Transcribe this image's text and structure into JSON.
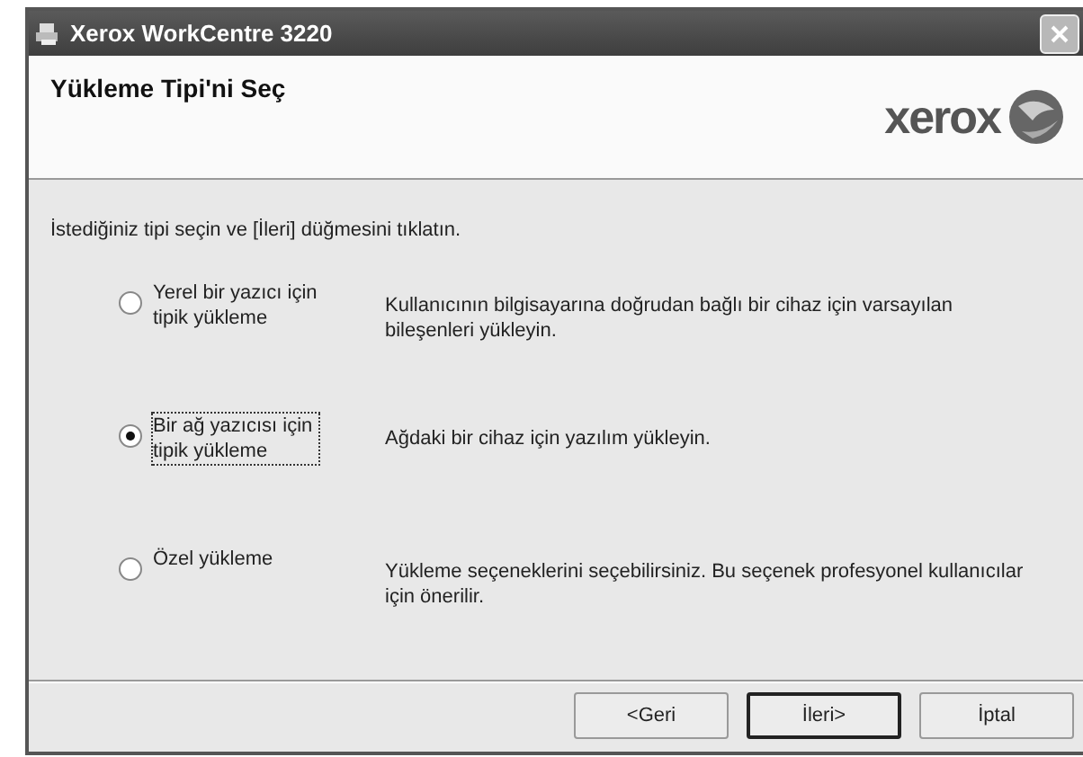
{
  "window": {
    "title": "Xerox WorkCentre 3220"
  },
  "header": {
    "title": "Yükleme Tipi'ni Seç",
    "logo": "xerox"
  },
  "instruction": "İstediğiniz tipi seçin ve [İleri] düğmesini tıklatın.",
  "options": [
    {
      "label": "Yerel bir yazıcı için tipik yükleme",
      "description": "Kullanıcının bilgisayarına doğrudan bağlı bir cihaz için varsayılan bileşenleri yükleyin.",
      "selected": false
    },
    {
      "label": "Bir ağ yazıcısı için tipik yükleme",
      "description": "Ağdaki bir cihaz için yazılım yükleyin.",
      "selected": true
    },
    {
      "label": "Özel yükleme",
      "description": "Yükleme seçeneklerini seçebilirsiniz. Bu seçenek profesyonel kullanıcılar için önerilir.",
      "selected": false
    }
  ],
  "buttons": [
    {
      "label": "<Geri",
      "default": false
    },
    {
      "label": "İleri>",
      "default": true
    },
    {
      "label": "İptal",
      "default": false
    }
  ]
}
